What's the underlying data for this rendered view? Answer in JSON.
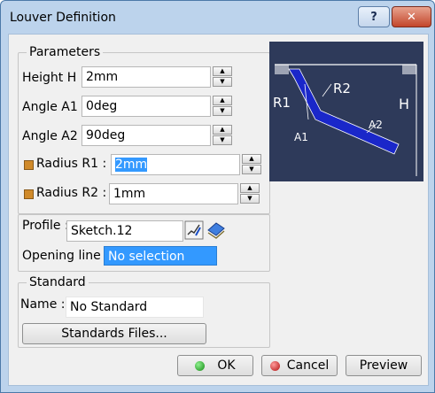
{
  "window": {
    "title": "Louver Definition",
    "help_label": "?",
    "close_label": "✕"
  },
  "parameters": {
    "legend": "Parameters",
    "height": {
      "label": "Height H :",
      "value": "2mm"
    },
    "angle_a1": {
      "label": "Angle A1 :",
      "value": "0deg"
    },
    "angle_a2": {
      "label": "Angle A2 :",
      "value": "90deg"
    },
    "radius_r1": {
      "label": "Radius R1 :",
      "value": "2mm",
      "checked": true
    },
    "radius_r2": {
      "label": "Radius R2 :",
      "value": "1mm",
      "checked": true
    }
  },
  "diagram": {
    "labels": {
      "r1": "R1",
      "r2": "R2",
      "a1": "A1",
      "a2": "A2",
      "h": "H"
    }
  },
  "profile": {
    "profile_label": "Profile :",
    "profile_value": "Sketch.12",
    "opening_label": "Opening line :",
    "opening_value": "No selection"
  },
  "standard": {
    "legend": "Standard",
    "name_label": "Name :",
    "name_value": "No Standard",
    "files_button": "Standards Files..."
  },
  "buttons": {
    "ok": "OK",
    "cancel": "Cancel",
    "preview": "Preview"
  },
  "colors": {
    "accent": "#3399ff",
    "diagram_bg": "#2e3a5a",
    "part": "#1a27c9"
  }
}
